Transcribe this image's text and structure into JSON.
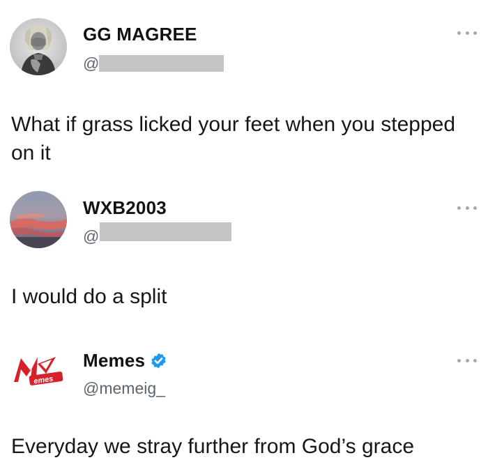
{
  "posts": [
    {
      "display_name": "GG MAGREE",
      "handle": "@",
      "handle_redacted": true,
      "avatar_icon": "person-photo-avatar",
      "more_icon": "more-options-icon",
      "text": "What if grass licked your feet when you stepped on it"
    },
    {
      "display_name": "WXB2003",
      "handle": "@",
      "handle_redacted": true,
      "avatar_icon": "sunset-sky-avatar",
      "more_icon": "more-options-icon",
      "text": "I would do a split"
    },
    {
      "display_name": "Memes",
      "handle": "@memeig_",
      "handle_redacted": false,
      "verified": true,
      "avatar_icon": "memes-logo-avatar",
      "more_icon": "more-options-icon",
      "text": "Everyday we stray further from God’s grace"
    }
  ],
  "colors": {
    "verified_badge": "#1d9bf0",
    "handle_text": "#5b6570",
    "redaction": "#c4c4c4",
    "logo_red": "#d6202a"
  }
}
